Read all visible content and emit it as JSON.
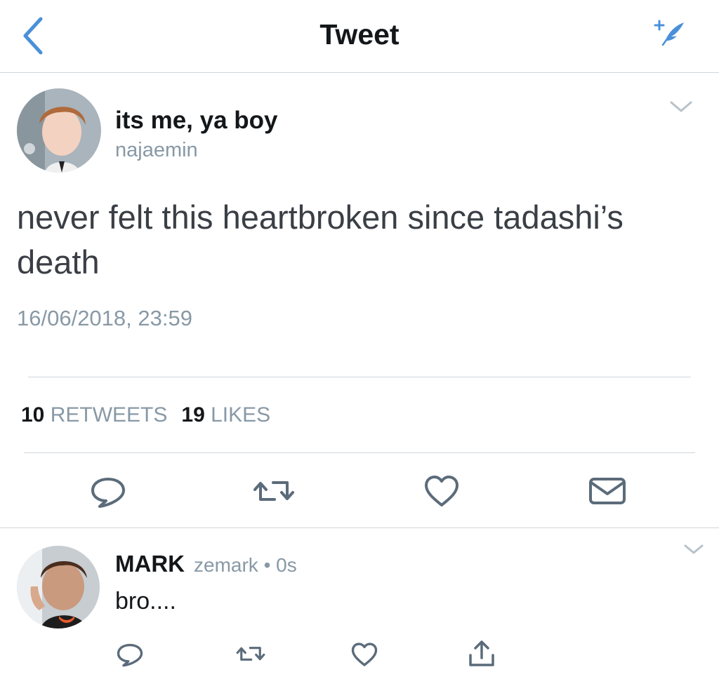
{
  "header": {
    "title": "Tweet",
    "back_icon": "chevron-left-icon",
    "compose_icon": "compose-feather-icon",
    "accent_color": "#4a90d9"
  },
  "tweet": {
    "author_name": "its me, ya boy",
    "author_handle": "najaemin",
    "text": "never felt this heartbroken since tadashi’s death",
    "timestamp": "16/06/2018, 23:59",
    "retweets_count": "10",
    "retweets_label": "RETWEETS",
    "likes_count": "19",
    "likes_label": "LIKES",
    "actions": [
      "reply-icon",
      "retweet-icon",
      "like-icon",
      "message-icon"
    ]
  },
  "reply": {
    "author_name": "MARK",
    "author_handle": "zemark",
    "separator": "•",
    "time_ago": "0s",
    "text": "bro....",
    "actions": [
      "reply-icon",
      "retweet-icon",
      "like-icon",
      "share-icon"
    ]
  }
}
